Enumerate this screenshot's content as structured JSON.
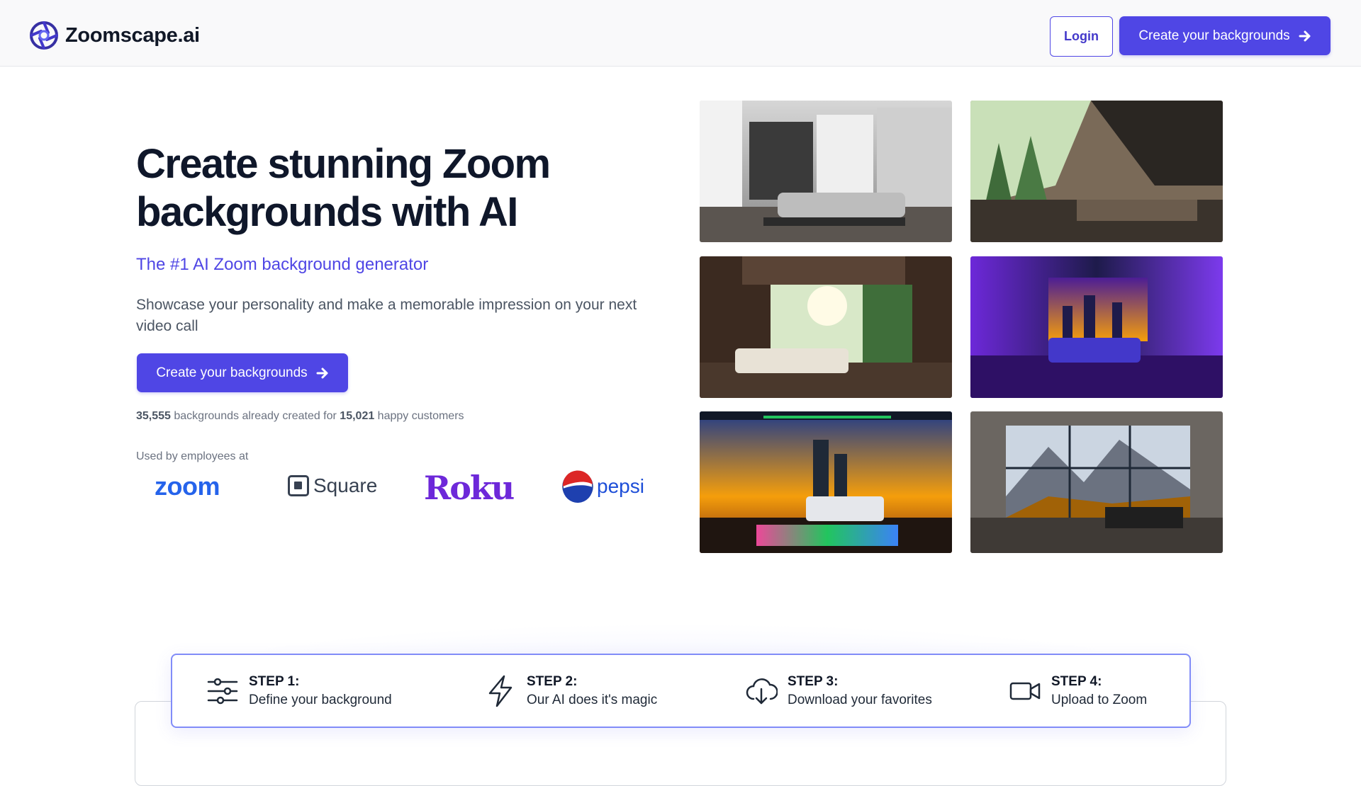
{
  "header": {
    "brand_name": "Zoomscape.ai",
    "login_label": "Login",
    "cta_label": "Create your backgrounds"
  },
  "hero": {
    "title": "Create stunning Zoom backgrounds with AI",
    "subtitle": "The #1 AI Zoom background generator",
    "description": "Showcase your personality and make a memorable impression on your next video call",
    "cta_label": "Create your backgrounds",
    "stats": {
      "backgrounds_count": "35,555",
      "backgrounds_text": " backgrounds already created for ",
      "customers_count": "15,021",
      "customers_text": " happy customers"
    },
    "used_by_label": "Used by employees at",
    "logos": [
      "zoom",
      "Square",
      "Roku",
      "pepsi"
    ]
  },
  "steps": [
    {
      "title": "STEP 1:",
      "text": "Define your background",
      "icon": "sliders-icon"
    },
    {
      "title": "STEP 2:",
      "text": "Our AI does it's magic",
      "icon": "lightning-icon"
    },
    {
      "title": "STEP 3:",
      "text": "Download your favorites",
      "icon": "cloud-download-icon"
    },
    {
      "title": "STEP 4:",
      "text": "Upload to Zoom",
      "icon": "video-camera-icon"
    }
  ],
  "colors": {
    "accent": "#4f46e5",
    "subtitle": "#4f46e5",
    "steps_border": "#818cf8",
    "zoom_brand": "#2563eb",
    "roku_brand": "#6d28d9",
    "pepsi_brand": "#1d4ed8"
  }
}
